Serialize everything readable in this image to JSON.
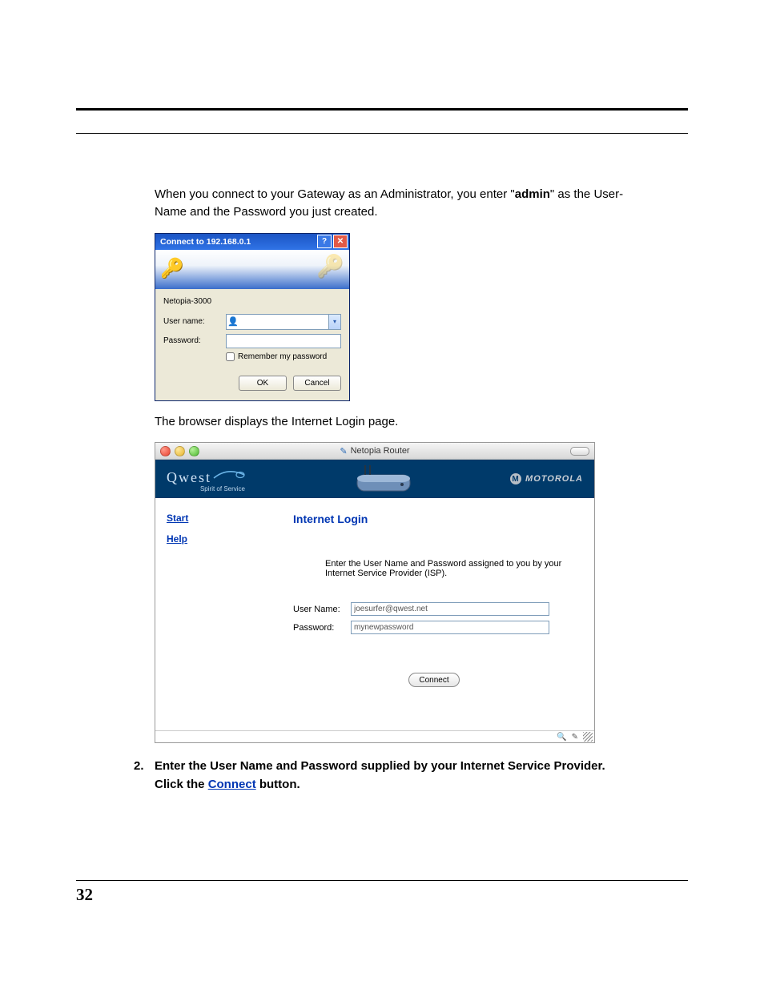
{
  "page_number": "32",
  "intro": {
    "part1": "When you connect to your Gateway as an Administrator, you enter \"",
    "bold": "admin",
    "part2": "\" as the User-Name and the Password you just created."
  },
  "xp": {
    "title": "Connect to 192.168.0.1",
    "realm": "Netopia-3000",
    "username_label": "User name:",
    "password_label": "Password:",
    "username_value": "",
    "password_value": "",
    "remember_label": "Remember my password",
    "ok": "OK",
    "cancel": "Cancel"
  },
  "mid_text": "The browser displays the Internet Login page.",
  "mac": {
    "title": "Netopia Router",
    "brand": "Qwest",
    "tagline": "Spirit of Service",
    "moto": "MOTOROLA",
    "side": {
      "start": "Start",
      "help": "Help"
    },
    "main": {
      "title": "Internet Login",
      "instr": "Enter the User Name and Password assigned to you by your Internet Service Provider (ISP).",
      "user_label": "User Name:",
      "pass_label": "Password:",
      "user_value": "joesurfer@qwest.net",
      "pass_value": "mynewpassword",
      "connect": "Connect"
    }
  },
  "step": {
    "num": "2.",
    "text1": "Enter the User Name and Password supplied by your Internet Service Provider. Click the ",
    "link": "Connect",
    "text2": " button."
  }
}
